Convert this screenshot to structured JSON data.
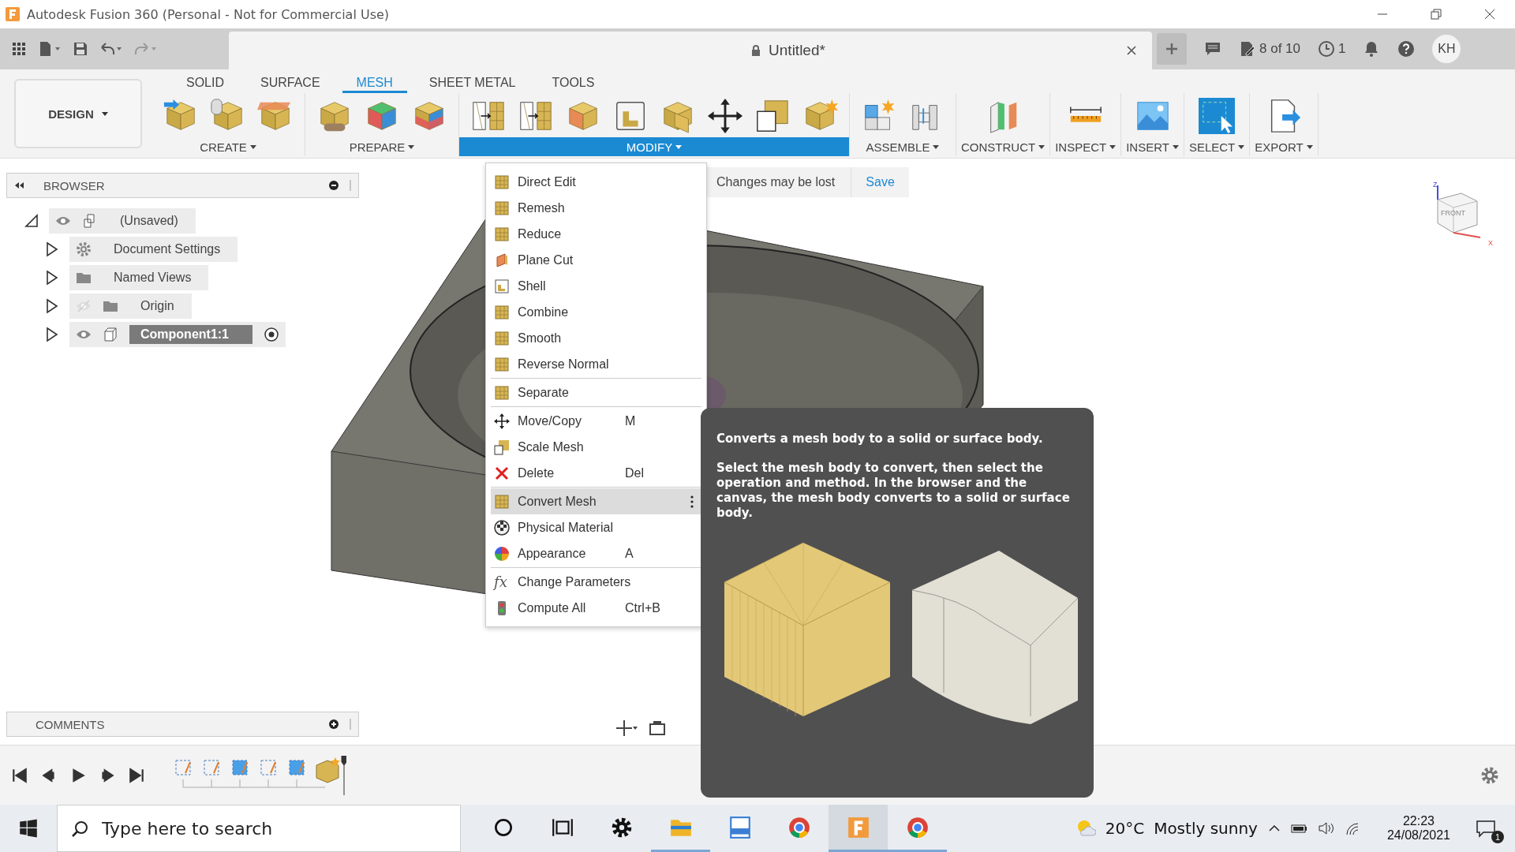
{
  "window": {
    "title": "Autodesk Fusion 360 (Personal - Not for Commercial Use)"
  },
  "toolbar": {
    "document_title": "Untitled*",
    "jobs": "8 of 10",
    "versions": "1",
    "user_initials": "KH"
  },
  "ribbon": {
    "workspace": "DESIGN",
    "tabs": [
      {
        "label": "SOLID",
        "selected": false
      },
      {
        "label": "SURFACE",
        "selected": false
      },
      {
        "label": "MESH",
        "selected": true
      },
      {
        "label": "SHEET METAL",
        "selected": false
      },
      {
        "label": "TOOLS",
        "selected": false
      }
    ],
    "groups": [
      {
        "label": "CREATE",
        "selected": false,
        "tools": [
          {
            "kind": "arrowcube"
          },
          {
            "kind": "cylcube"
          },
          {
            "kind": "plate"
          }
        ]
      },
      {
        "label": "PREPARE",
        "selected": false,
        "tools": [
          {
            "kind": "patchcube"
          },
          {
            "kind": "colorcube"
          },
          {
            "kind": "bicolor"
          }
        ]
      },
      {
        "label": "MODIFY",
        "selected": true,
        "tools": [
          {
            "kind": "remesh"
          },
          {
            "kind": "reduce"
          },
          {
            "kind": "cut"
          },
          {
            "kind": "shell"
          },
          {
            "kind": "combine"
          },
          {
            "kind": "move"
          },
          {
            "kind": "scale"
          },
          {
            "kind": "starcube"
          }
        ]
      },
      {
        "label": "ASSEMBLE",
        "selected": false,
        "tools": [
          {
            "kind": "assemble"
          },
          {
            "kind": "joint"
          }
        ]
      },
      {
        "label": "CONSTRUCT",
        "selected": false,
        "tools": [
          {
            "kind": "plane"
          }
        ]
      },
      {
        "label": "INSPECT",
        "selected": false,
        "tools": [
          {
            "kind": "ruler"
          }
        ]
      },
      {
        "label": "INSERT",
        "selected": false,
        "tools": [
          {
            "kind": "image"
          }
        ]
      },
      {
        "label": "SELECT",
        "selected": false,
        "tools": [
          {
            "kind": "select"
          }
        ]
      },
      {
        "label": "EXPORT",
        "selected": false,
        "tools": [
          {
            "kind": "export"
          }
        ]
      }
    ]
  },
  "browser": {
    "title": "BROWSER",
    "tree": [
      {
        "label": "(Unsaved)",
        "kind": "component",
        "visible": true,
        "expanded": true,
        "selected": false,
        "children": [
          {
            "label": "Document Settings",
            "kind": "settings",
            "expanded": false,
            "selected": false
          },
          {
            "label": "Named Views",
            "kind": "folder",
            "expanded": false,
            "selected": false
          },
          {
            "label": "Origin",
            "kind": "folder",
            "visible": false,
            "expanded": false,
            "selected": false
          },
          {
            "label": "Component1:1",
            "kind": "component",
            "visible": true,
            "expanded": false,
            "selected": true
          }
        ]
      }
    ]
  },
  "notice": {
    "message": "Changes may be lost",
    "action": "Save"
  },
  "modify_menu": {
    "groups": [
      [
        {
          "label": "Direct Edit",
          "kind": "mesh",
          "selected": false
        },
        {
          "label": "Remesh",
          "kind": "mesh",
          "selected": false
        },
        {
          "label": "Reduce",
          "kind": "mesh",
          "selected": false
        },
        {
          "label": "Plane Cut",
          "kind": "cut",
          "selected": false
        },
        {
          "label": "Shell",
          "kind": "shell",
          "selected": false
        },
        {
          "label": "Combine",
          "kind": "mesh",
          "selected": false
        },
        {
          "label": "Smooth",
          "kind": "mesh",
          "selected": false
        },
        {
          "label": "Reverse Normal",
          "kind": "mesh",
          "selected": false
        }
      ],
      [
        {
          "label": "Separate",
          "kind": "mesh",
          "selected": false
        }
      ],
      [
        {
          "label": "Move/Copy",
          "kind": "move",
          "shortcut": "M",
          "selected": false
        },
        {
          "label": "Scale Mesh",
          "kind": "scale",
          "selected": false
        },
        {
          "label": "Delete",
          "kind": "delete",
          "shortcut": "Del",
          "selected": false
        }
      ],
      [
        {
          "label": "Convert Mesh",
          "kind": "mesh",
          "selected": true
        },
        {
          "label": "Physical Material",
          "kind": "material",
          "selected": false
        },
        {
          "label": "Appearance",
          "kind": "appearance",
          "shortcut": "A",
          "selected": false
        }
      ],
      [
        {
          "label": "Change Parameters",
          "kind": "formula",
          "glyph": "fx",
          "selected": false
        },
        {
          "label": "Compute All",
          "kind": "compute",
          "shortcut": "Ctrl+B",
          "selected": false
        }
      ]
    ]
  },
  "tooltip": {
    "title": "Converts a mesh body to a solid or surface body.",
    "body": "Select the mesh body to convert, then select the operation and method. In the browser and the canvas, the mesh body converts to a solid or surface body."
  },
  "viewcube": {
    "face": "FRONT",
    "axes": [
      "Z",
      "X"
    ]
  },
  "comments": {
    "title": "COMMENTS"
  },
  "taskbar": {
    "search_placeholder": "Type here to search",
    "apps": [
      {
        "kind": "cortana",
        "running": false,
        "selected": false
      },
      {
        "kind": "taskview",
        "running": false,
        "selected": false
      },
      {
        "kind": "settings",
        "running": false,
        "selected": false
      },
      {
        "kind": "explorer",
        "running": true,
        "selected": false
      },
      {
        "kind": "archive",
        "running": false,
        "selected": false
      },
      {
        "kind": "browser",
        "running": false,
        "selected": false
      },
      {
        "kind": "cad",
        "running": true,
        "selected": true
      },
      {
        "kind": "browser",
        "running": true,
        "selected": false
      }
    ],
    "weather": {
      "temperature": "20°C",
      "condition": "Mostly sunny"
    },
    "time": "22:23",
    "date": "24/08/2021",
    "notifications": "1"
  }
}
